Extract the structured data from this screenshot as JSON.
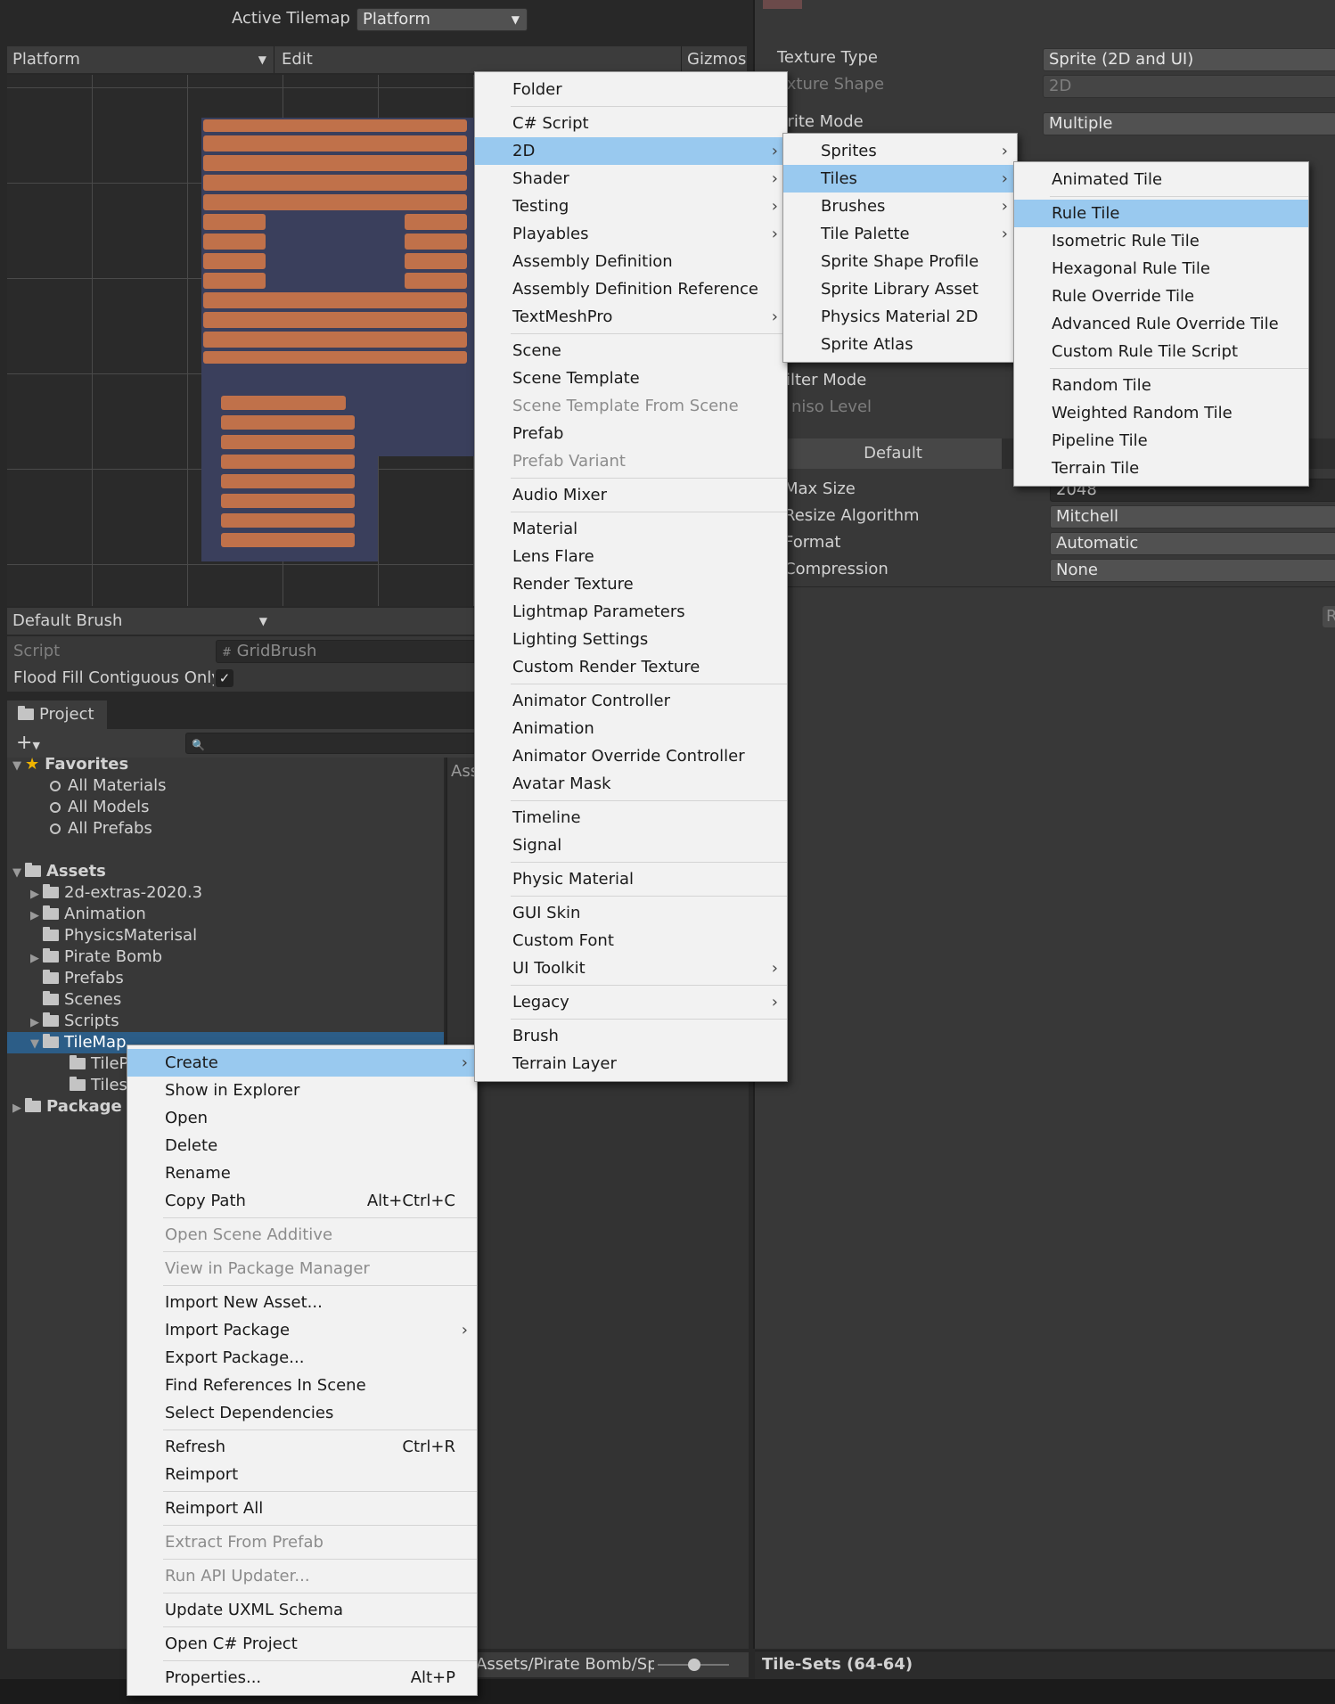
{
  "toolbar": {
    "active_tilemap_label": "Active Tilemap",
    "active_tilemap_value": "Platform"
  },
  "palette": {
    "dropdown": "Platform",
    "edit": "Edit",
    "gizmos": "Gizmos"
  },
  "brush": {
    "name": "Default Brush",
    "script_label": "Script",
    "script_value": "GridBrush",
    "flood_label": "Flood Fill Contiguous Only",
    "flood_checked": true
  },
  "project": {
    "tab": "Project",
    "assets_header": "Ass",
    "favorites": {
      "label": "Favorites",
      "items": [
        "All Materials",
        "All Models",
        "All Prefabs"
      ]
    },
    "assets": {
      "label": "Assets",
      "items": [
        "2d-extras-2020.3",
        "Animation",
        "PhysicsMaterisal",
        "Pirate Bomb",
        "Prefabs",
        "Scenes",
        "Scripts",
        "TileMap"
      ]
    },
    "tilemap_children": [
      "TileP",
      "Tiles"
    ],
    "packages": "Package",
    "path_footer": "Assets/Pirate Bomb/Spr"
  },
  "inspector": {
    "rows": [
      {
        "label": "Texture Type",
        "value": "Sprite (2D and UI)"
      },
      {
        "label": "exture Shape",
        "value": "2D"
      },
      {
        "label": "prite Mode",
        "value": "Multiple"
      }
    ],
    "filter_mode": "ilter Mode",
    "aniso_level": "niso Level",
    "platform_tab": "Default",
    "settings": [
      {
        "label": "Max Size",
        "value": "2048"
      },
      {
        "label": "Resize Algorithm",
        "value": "Mitchell"
      },
      {
        "label": "Format",
        "value": "Automatic"
      },
      {
        "label": "Compression",
        "value": "None"
      }
    ],
    "footer": "Tile-Sets (64-64)",
    "r_button": "R"
  },
  "context_menu": {
    "items": [
      {
        "label": "Create",
        "submenu": true,
        "highlight": true
      },
      {
        "label": "Show in Explorer"
      },
      {
        "label": "Open"
      },
      {
        "label": "Delete"
      },
      {
        "label": "Rename"
      },
      {
        "label": "Copy Path",
        "shortcut": "Alt+Ctrl+C"
      },
      {
        "sep": true
      },
      {
        "label": "Open Scene Additive",
        "disabled": true
      },
      {
        "sep": true
      },
      {
        "label": "View in Package Manager",
        "disabled": true
      },
      {
        "sep": true
      },
      {
        "label": "Import New Asset..."
      },
      {
        "label": "Import Package",
        "submenu": true
      },
      {
        "label": "Export Package..."
      },
      {
        "label": "Find References In Scene"
      },
      {
        "label": "Select Dependencies"
      },
      {
        "sep": true
      },
      {
        "label": "Refresh",
        "shortcut": "Ctrl+R"
      },
      {
        "label": "Reimport"
      },
      {
        "sep": true
      },
      {
        "label": "Reimport All"
      },
      {
        "sep": true
      },
      {
        "label": "Extract From Prefab",
        "disabled": true
      },
      {
        "sep": true
      },
      {
        "label": "Run API Updater...",
        "disabled": true
      },
      {
        "sep": true
      },
      {
        "label": "Update UXML Schema"
      },
      {
        "sep": true
      },
      {
        "label": "Open C# Project"
      },
      {
        "sep": true
      },
      {
        "label": "Properties...",
        "shortcut": "Alt+P"
      }
    ]
  },
  "create_menu": {
    "items": [
      {
        "label": "Folder"
      },
      {
        "sep": true
      },
      {
        "label": "C# Script"
      },
      {
        "label": "2D",
        "submenu": true,
        "highlight": true
      },
      {
        "label": "Shader",
        "submenu": true
      },
      {
        "label": "Testing",
        "submenu": true
      },
      {
        "label": "Playables",
        "submenu": true
      },
      {
        "label": "Assembly Definition"
      },
      {
        "label": "Assembly Definition Reference"
      },
      {
        "label": "TextMeshPro",
        "submenu": true
      },
      {
        "sep": true
      },
      {
        "label": "Scene"
      },
      {
        "label": "Scene Template"
      },
      {
        "label": "Scene Template From Scene",
        "disabled": true
      },
      {
        "label": "Prefab"
      },
      {
        "label": "Prefab Variant",
        "disabled": true
      },
      {
        "sep": true
      },
      {
        "label": "Audio Mixer"
      },
      {
        "sep": true
      },
      {
        "label": "Material"
      },
      {
        "label": "Lens Flare"
      },
      {
        "label": "Render Texture"
      },
      {
        "label": "Lightmap Parameters"
      },
      {
        "label": "Lighting Settings"
      },
      {
        "label": "Custom Render Texture"
      },
      {
        "sep": true
      },
      {
        "label": "Animator Controller"
      },
      {
        "label": "Animation"
      },
      {
        "label": "Animator Override Controller"
      },
      {
        "label": "Avatar Mask"
      },
      {
        "sep": true
      },
      {
        "label": "Timeline"
      },
      {
        "label": "Signal"
      },
      {
        "sep": true
      },
      {
        "label": "Physic Material"
      },
      {
        "sep": true
      },
      {
        "label": "GUI Skin"
      },
      {
        "label": "Custom Font"
      },
      {
        "label": "UI Toolkit",
        "submenu": true
      },
      {
        "sep": true
      },
      {
        "label": "Legacy",
        "submenu": true
      },
      {
        "sep": true
      },
      {
        "label": "Brush"
      },
      {
        "label": "Terrain Layer"
      }
    ]
  },
  "twod_menu": {
    "items": [
      {
        "label": "Sprites",
        "submenu": true
      },
      {
        "label": "Tiles",
        "submenu": true,
        "highlight": true
      },
      {
        "label": "Brushes",
        "submenu": true
      },
      {
        "label": "Tile Palette",
        "submenu": true
      },
      {
        "label": "Sprite Shape Profile"
      },
      {
        "label": "Sprite Library Asset"
      },
      {
        "label": "Physics Material 2D"
      },
      {
        "label": "Sprite Atlas"
      }
    ]
  },
  "tiles_menu": {
    "items": [
      {
        "label": "Animated Tile"
      },
      {
        "sep": true
      },
      {
        "label": "Rule Tile",
        "highlight": true
      },
      {
        "label": "Isometric Rule Tile"
      },
      {
        "label": "Hexagonal Rule Tile"
      },
      {
        "label": "Rule Override Tile"
      },
      {
        "label": "Advanced Rule Override Tile"
      },
      {
        "label": "Custom Rule Tile Script"
      },
      {
        "sep": true
      },
      {
        "label": "Random Tile"
      },
      {
        "label": "Weighted Random Tile"
      },
      {
        "label": "Pipeline Tile"
      },
      {
        "label": "Terrain Tile"
      }
    ]
  },
  "colors": {
    "highlight": "#99c9ef",
    "selection": "#2c5d87",
    "brick": "#c0714a",
    "tile_bg": "#3a3f5c"
  }
}
